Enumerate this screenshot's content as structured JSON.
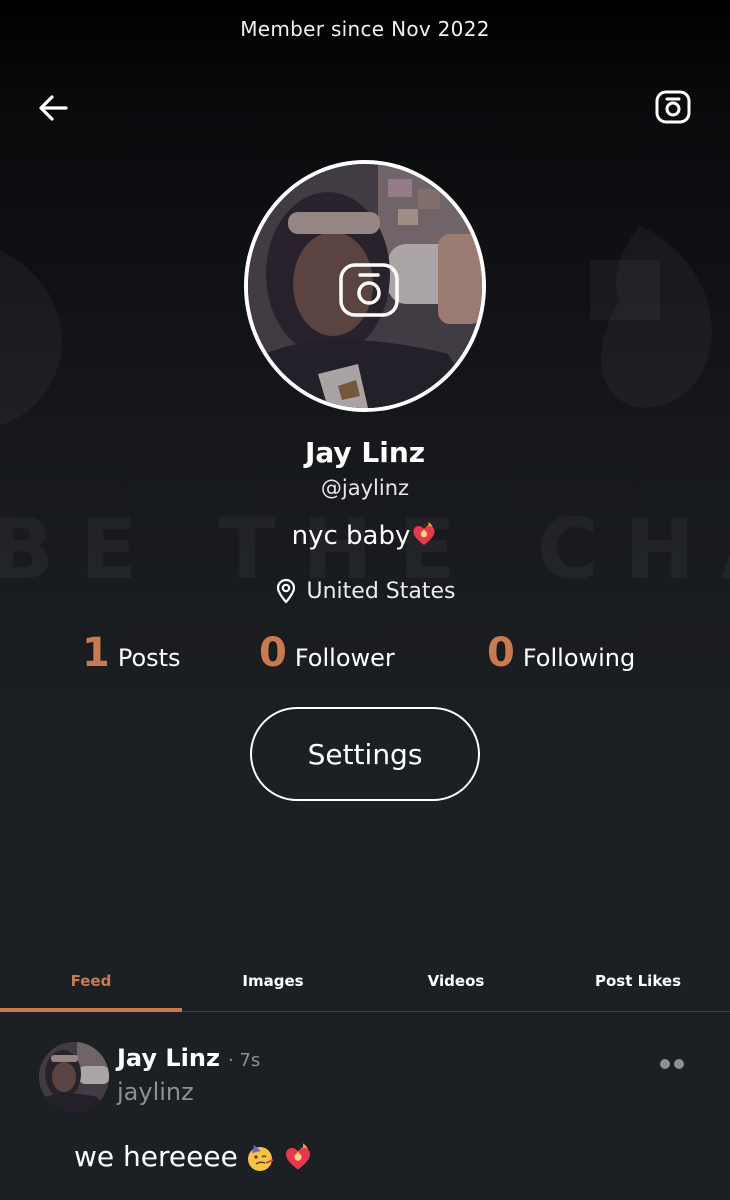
{
  "header": {
    "member_since": "Member since Nov 2022"
  },
  "icons": {
    "back": "arrow-left-icon",
    "camera": "camera-icon",
    "location": "location-pin-icon",
    "more": "more-dots-icon"
  },
  "background": {
    "watermark_text": "BE THE CHANGE"
  },
  "profile": {
    "name": "Jay Linz",
    "handle": "@jaylinz",
    "bio": "nyc baby",
    "location": "United States"
  },
  "stats": [
    {
      "value": "1",
      "label": "Posts"
    },
    {
      "value": "0",
      "label": "Follower"
    },
    {
      "value": "0",
      "label": "Following"
    }
  ],
  "settings_label": "Settings",
  "tabs": [
    {
      "label": "Feed",
      "active": true
    },
    {
      "label": "Images",
      "active": false
    },
    {
      "label": "Videos",
      "active": false
    },
    {
      "label": "Post Likes",
      "active": false
    }
  ],
  "post": {
    "author_name": "Jay Linz",
    "time": "· 7s",
    "author_handle": "jaylinz",
    "text": "we hereeee"
  },
  "colors": {
    "accent": "#c97a4e",
    "background": "#1c1f23",
    "muted_text": "#8c9096"
  }
}
